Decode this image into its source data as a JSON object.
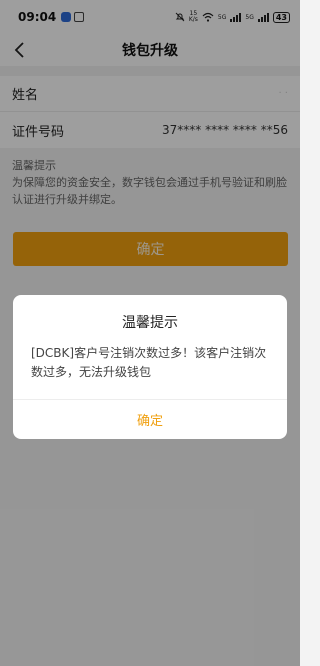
{
  "status_bar": {
    "time": "09:04",
    "net_speed_top": "15",
    "net_speed_bottom": "K/s",
    "sig1_label": "5G",
    "sig2_label": "5G",
    "battery": "43"
  },
  "nav": {
    "title": "钱包升级"
  },
  "form": {
    "name_label": "姓名",
    "name_value": "· ·",
    "id_label": "证件号码",
    "id_value": "37**** **** **** **56"
  },
  "tips": {
    "title": "温馨提示",
    "text": "为保障您的资金安全，数字钱包会通过手机号验证和刷脸认证进行升级并绑定。"
  },
  "confirm_button": "确定",
  "dialog": {
    "title": "温馨提示",
    "message": "[DCBK]客户号注销次数过多！该客户注销次数过多，无法升级钱包",
    "button": "确定"
  },
  "colors": {
    "accent": "#f0a010",
    "overlay": "rgba(0,0,0,0.38)"
  }
}
